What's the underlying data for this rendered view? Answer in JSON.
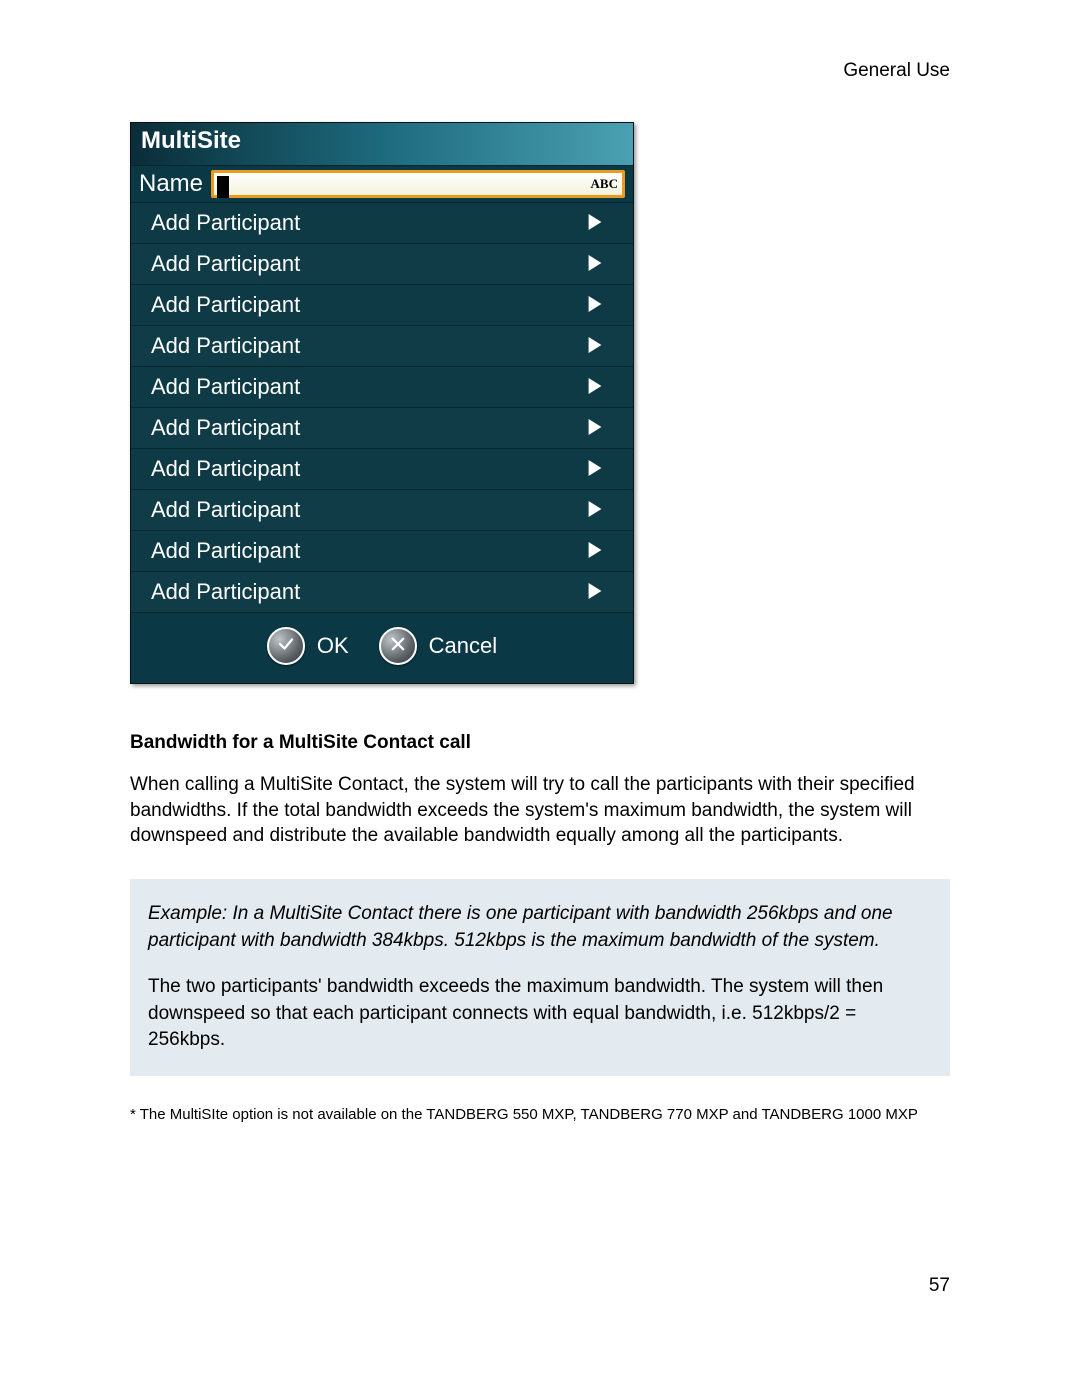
{
  "header": {
    "section": "General Use"
  },
  "panel": {
    "title": "MultiSite",
    "name_label": "Name",
    "abc_indicator": "ABC",
    "participants": [
      "Add Participant",
      "Add Participant",
      "Add Participant",
      "Add Participant",
      "Add Participant",
      "Add Participant",
      "Add Participant",
      "Add Participant",
      "Add Participant",
      "Add Participant"
    ],
    "ok_label": "OK",
    "cancel_label": "Cancel"
  },
  "content": {
    "heading": "Bandwidth for a MultiSite Contact call",
    "paragraph1": "When calling a MultiSite Contact, the system will try to call the participants with their specified bandwidths. If the total bandwidth exceeds the system's maximum bandwidth, the system will downspeed and distribute the available bandwidth equally among all the participants.",
    "example_intro": "Example:  In a MultiSite Contact there is one participant with bandwidth 256kbps and one participant with bandwidth 384kbps. 512kbps is the maximum bandwidth of the system.",
    "example_body": "The two participants' bandwidth exceeds the maximum bandwidth. The system will then downspeed so that each participant connects with equal bandwidth, i.e. 512kbps/2 = 256kbps.",
    "footnote": "* The MultiSIte option is not available on the TANDBERG 550 MXP, TANDBERG 770 MXP and TANDBERG 1000 MXP"
  },
  "page_number": "57"
}
